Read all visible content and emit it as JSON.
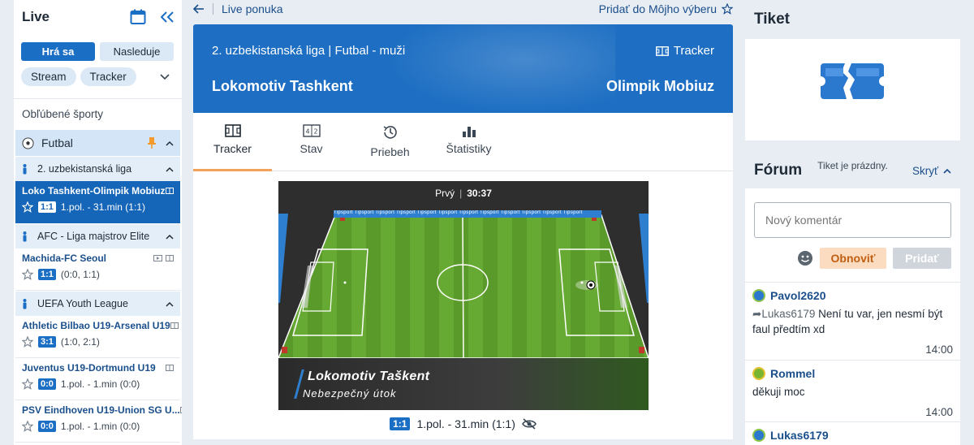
{
  "left": {
    "title": "Live",
    "segments": {
      "playing": "Hrá sa",
      "upcoming": "Nasleduje"
    },
    "pills": {
      "stream": "Stream",
      "tracker": "Tracker"
    },
    "favorites_label": "Obľúbené športy",
    "sport": {
      "name": "Futbal"
    },
    "leagues": [
      {
        "name": "2. uzbekistanská liga"
      },
      {
        "name": "AFC - Liga majstrov Elite"
      },
      {
        "name": "UEFA Youth League"
      }
    ],
    "matches": [
      {
        "name": "Loko Tashkent-Olimpik Mobiuz",
        "score": "1:1",
        "detail": "1.pol. - 31.min (1:1)"
      },
      {
        "name": "Machida-FC Seoul",
        "score": "1:1",
        "detail": "(0:0, 1:1)"
      },
      {
        "name": "Athletic Bilbao U19-Arsenal U19",
        "score": "3:1",
        "detail": "(1:0, 2:1)"
      },
      {
        "name": "Juventus U19-Dortmund U19",
        "score": "0:0",
        "detail": "1.pol. - 1.min (0:0)"
      },
      {
        "name": "PSV Eindhoven U19-Union SG U...",
        "score": "0:0",
        "detail": "1.pol. - 1.min (0:0)"
      }
    ]
  },
  "center": {
    "back_label": "Live ponuka",
    "add_fav_label": "Pridať do Môjho výberu",
    "league_line": "2. uzbekistanská liga | Futbal - muži",
    "tracker_label": "Tracker",
    "home": "Lokomotiv Tashkent",
    "away": "Olimpik Mobiuz",
    "tabs": [
      "Tracker",
      "Stav",
      "Priebeh",
      "Štatistiky"
    ],
    "hud": {
      "half": "Prvý",
      "time": "30:37"
    },
    "board_text": "Tipsport  Tipsport  Tipsport  Tipsport  Tipsport  Tipsport  Tipsport  Tipsport  Tipsport  Tipsport  Tipsport  Tipsport",
    "caption_team": "Lokomotiv Taškent",
    "caption_event": "Nebezpečný útok",
    "score": "1:1",
    "status": "1.pol. - 31.min (1:1)"
  },
  "right": {
    "ticket_title": "Tiket",
    "ticket_empty": "Tiket je prázdny.",
    "forum_title": "Fórum",
    "hide_label": "Skryť",
    "comment_placeholder": "Nový komentár",
    "refresh_label": "Obnoviť",
    "add_label": "Pridať",
    "posts": [
      {
        "user": "Pavol2620",
        "reply_to": "Lukas6179",
        "text": "Není tu var, jen nesmí být faul předtím xd",
        "time": "14:00"
      },
      {
        "user": "Rommel",
        "text": "děkuji moc",
        "time": "14:00"
      },
      {
        "user": "Lukas6179"
      }
    ]
  },
  "colors": {
    "accent": "#1a6ec4",
    "banner": "#1e6fc3",
    "tab_underline": "#f3a25c",
    "refresh_bg": "#fbdcc0"
  }
}
